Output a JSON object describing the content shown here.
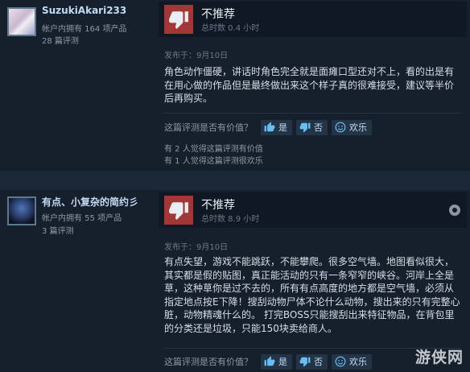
{
  "reviews": [
    {
      "username": "SuzukiAkari233",
      "products_owned": "帐户内拥有 164 项产品",
      "review_count": "28 篇评测",
      "verdict": "不推荐",
      "hours": "总时数 0.4 小时",
      "posted": "发布于：9月10日",
      "body_lines": [
        "角色动作僵硬，讲话时角色完全就是面瘫口型还对不上，看的出是有",
        "在用心做的作品但是最终做出来这个样子真的很难接受，建议等半价",
        "后再购买。"
      ],
      "helpful_question": "这篇评测是否有价值？",
      "yes_label": "是",
      "no_label": "否",
      "funny_label": "欢乐",
      "helpful_stats": [
        "有 2 人觉得这篇评测有价值",
        "有 1 人觉得这篇评测很欢乐"
      ]
    },
    {
      "username": "有点、小复杂的简约彡",
      "products_owned": "帐户内拥有 55 项产品",
      "review_count": "3 篇评测",
      "verdict": "不推荐",
      "hours": "总时数 8.9 小时",
      "posted": "发布于：9月10日",
      "body_lines": [
        "有点失望，游戏不能跳跃，不能攀爬。很多空气墙。地图看似很大，",
        "其实都是假的贴图，真正能活动的只有一条窄窄的峡谷。河岸上全是",
        "草，这种草你是过不去的，所有有点高度的地方都是空气墙，必须从",
        "指定地点按E下降！搜刮动物尸体不论什么动物，搜出来的只有完整心",
        "脏，动物精魂什么的。 打完BOSS只能搜刮出来特征物品，在背包里",
        "的分类还是垃圾，只能150块卖给商人。"
      ],
      "helpful_question": "这篇评测是否有价值？",
      "yes_label": "是",
      "no_label": "否",
      "funny_label": "欢乐"
    }
  ],
  "watermark": "游侠网",
  "colors": {
    "thumb_down_bg": "#a33636",
    "username": "#c1dbf4",
    "page_bg": "#1b2838"
  }
}
